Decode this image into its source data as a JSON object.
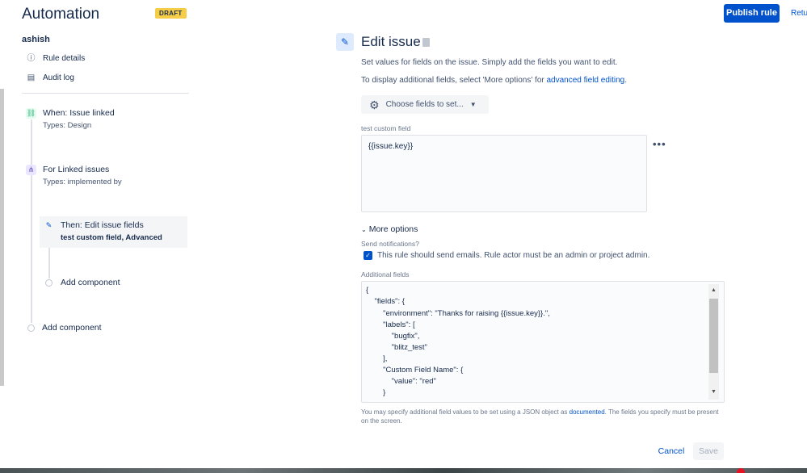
{
  "header": {
    "app_title": "Automation",
    "draft_badge": "DRAFT",
    "publish_label": "Publish rule",
    "return_label": "Retu"
  },
  "sidebar": {
    "user": "ashish",
    "links": [
      {
        "label": "Rule details",
        "icon": "info-icon"
      },
      {
        "label": "Audit log",
        "icon": "document-icon"
      }
    ],
    "nodes": [
      {
        "title": "When: Issue linked",
        "subtitle": "Types: Design",
        "icon": "link-icon",
        "color": "#36b37e"
      },
      {
        "title": "For Linked issues",
        "subtitle": "Types: implemented by",
        "icon": "branch-icon",
        "color": "#6554c0"
      },
      {
        "title": "Then: Edit issue fields",
        "subtitle": "test custom field, Advanced",
        "icon": "pencil-icon",
        "color": "#0052cc"
      }
    ],
    "add_component_inner": "Add component",
    "add_component_outer": "Add component"
  },
  "editor": {
    "title": "Edit issue",
    "desc1": "Set values for fields on the issue. Simply add the fields you want to edit.",
    "desc2_prefix": "To display additional fields, select 'More options' for ",
    "desc2_link": "advanced field editing",
    "desc2_suffix": ".",
    "choose_fields_label": "Choose fields to set...",
    "field_label": "test custom field",
    "field_value": "{{issue.key}}",
    "more_options_label": "More options",
    "send_notifications_label": "Send notifications?",
    "checkbox_label": "This rule should send emails. Rule actor must be an admin or project admin.",
    "additional_fields_label": "Additional fields",
    "code_lines": [
      "{",
      "    \"fields\": {",
      "        \"environment\": \"Thanks for raising {{issue.key}}.\",",
      "        \"labels\": [",
      "            \"bugfix\",",
      "            \"blitz_test\"",
      "        ],",
      "        \"Custom Field Name\": {",
      "            \"value\": \"red\"",
      "        }"
    ],
    "help_prefix": "You may specify additional field values to be set using a JSON object as ",
    "help_link": "documented",
    "help_suffix": ". The fields you specify must be present on the screen.",
    "cancel_label": "Cancel",
    "save_label": "Save"
  },
  "colors": {
    "primary": "#0052cc",
    "draft": "#f5cd47"
  }
}
